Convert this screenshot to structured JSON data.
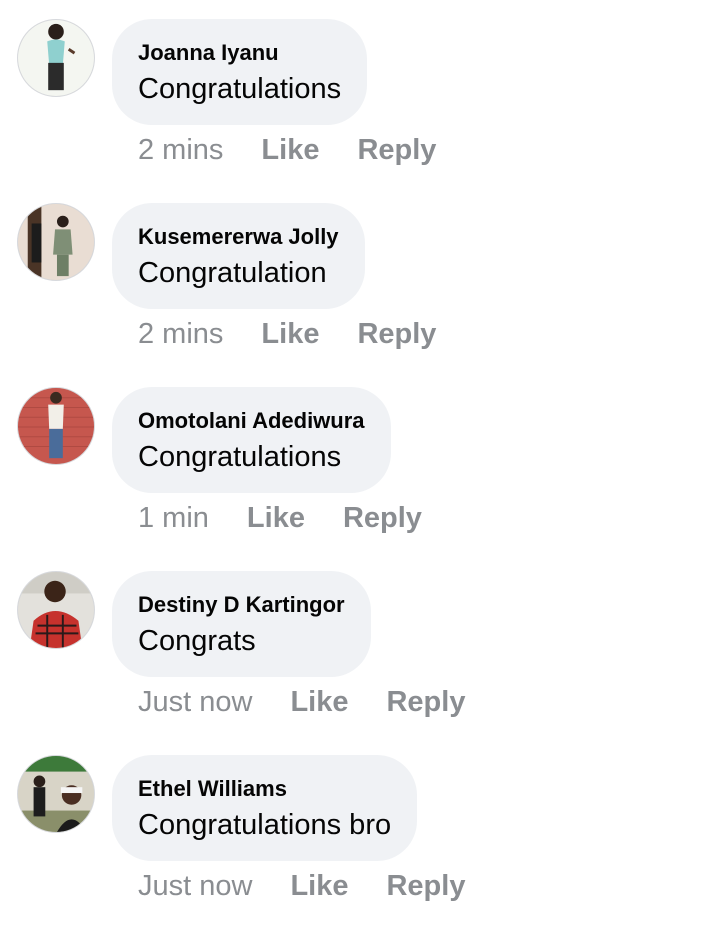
{
  "comments": [
    {
      "author": "Joanna Iyanu",
      "text": "Congratulations",
      "time": "2 mins",
      "like": "Like",
      "reply": "Reply"
    },
    {
      "author": "Kusemererwa Jolly",
      "text": "Congratulation",
      "time": "2 mins",
      "like": "Like",
      "reply": "Reply"
    },
    {
      "author": "Omotolani Adediwura",
      "text": "Congratulations",
      "time": "1 min",
      "like": "Like",
      "reply": "Reply"
    },
    {
      "author": "Destiny D Kartingor",
      "text": "Congrats",
      "time": "Just now",
      "like": "Like",
      "reply": "Reply"
    },
    {
      "author": "Ethel Williams",
      "text": "Congratulations bro",
      "time": "Just now",
      "like": "Like",
      "reply": "Reply"
    }
  ],
  "colors": {
    "bubble_background": "#f0f2f5",
    "name_text": "#050505",
    "meta_text": "#8a8d91"
  }
}
